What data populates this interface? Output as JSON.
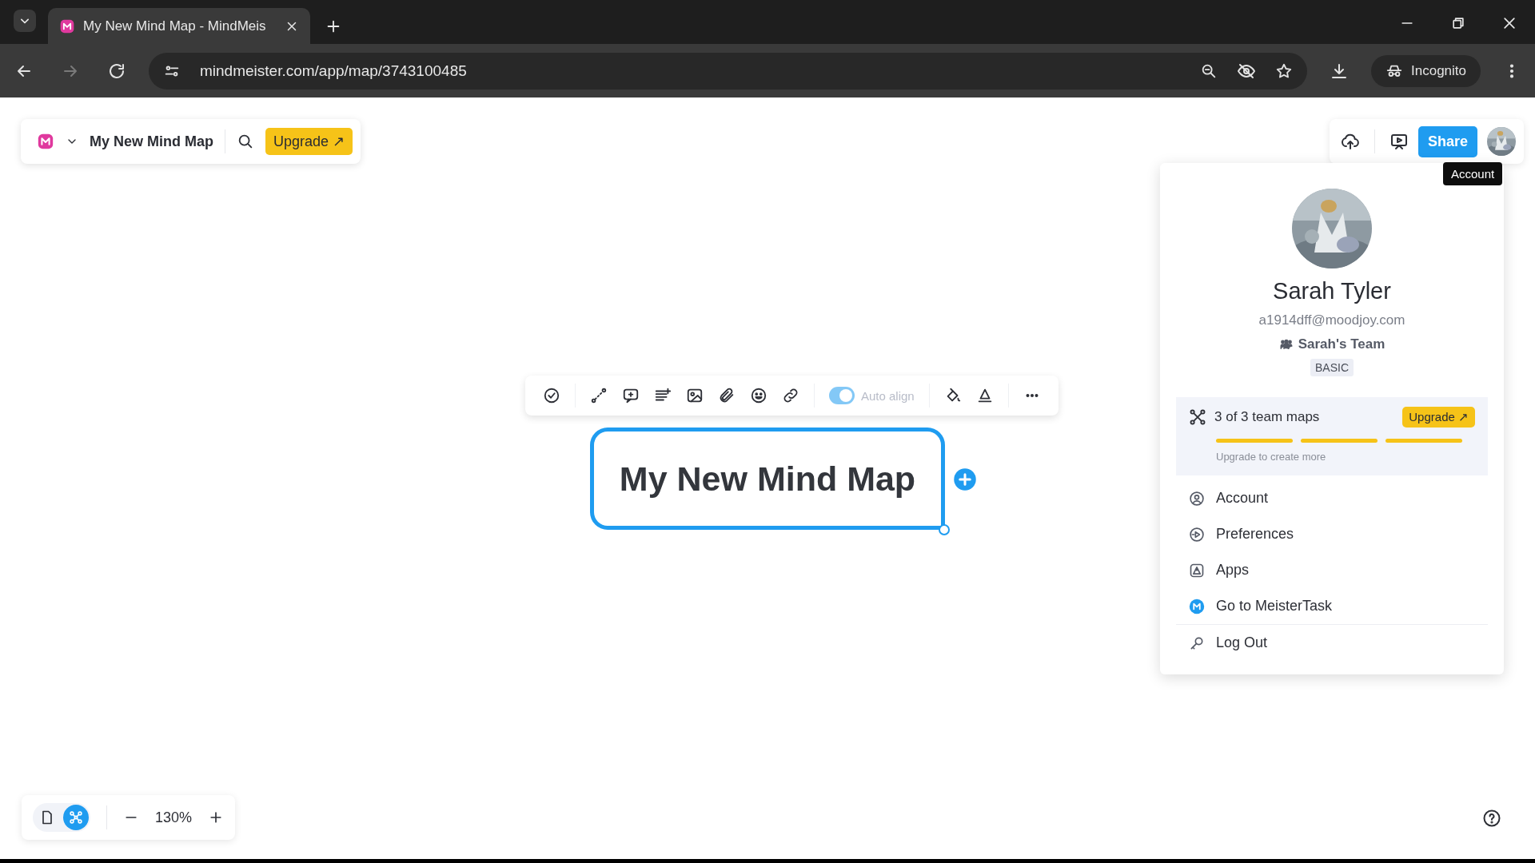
{
  "browser": {
    "tabs": [
      {
        "title": "My New Mind Map - MindMeis",
        "selected": true
      }
    ],
    "url": "mindmeister.com/app/map/3743100485",
    "profile": "Incognito"
  },
  "map_header": {
    "title": "My New Mind Map",
    "upgrade": "Upgrade ↗"
  },
  "node_toolbar": {
    "auto_align": {
      "label": "Auto align",
      "on": true,
      "disabled": true
    }
  },
  "central_node": {
    "text": "My New Mind Map",
    "selected": true
  },
  "top_actions": {
    "share": "Share",
    "tooltip": "Account"
  },
  "account_menu": {
    "name": "Sarah Tyler",
    "email": "a1914dff@moodjoy.com",
    "team": "Sarah's Team",
    "plan": "BASIC",
    "usage": {
      "text": "3 of 3 team maps",
      "upgrade": "Upgrade ↗",
      "hint": "Upgrade to create more",
      "segments": [
        {
          "filled": true
        },
        {
          "filled": true
        },
        {
          "filled": true
        }
      ]
    },
    "items": [
      {
        "label": "Account",
        "kind": "account"
      },
      {
        "label": "Preferences",
        "kind": "preferences"
      },
      {
        "label": "Apps",
        "kind": "apps"
      },
      {
        "label": "Go to MeisterTask",
        "kind": "meistertask"
      },
      {
        "label": "Log Out",
        "kind": "logout"
      }
    ]
  },
  "bottom_bar": {
    "view_modes": [
      {
        "kind": "outline",
        "selected": false
      },
      {
        "kind": "mindmap",
        "selected": true
      }
    ],
    "zoom": "130%"
  }
}
